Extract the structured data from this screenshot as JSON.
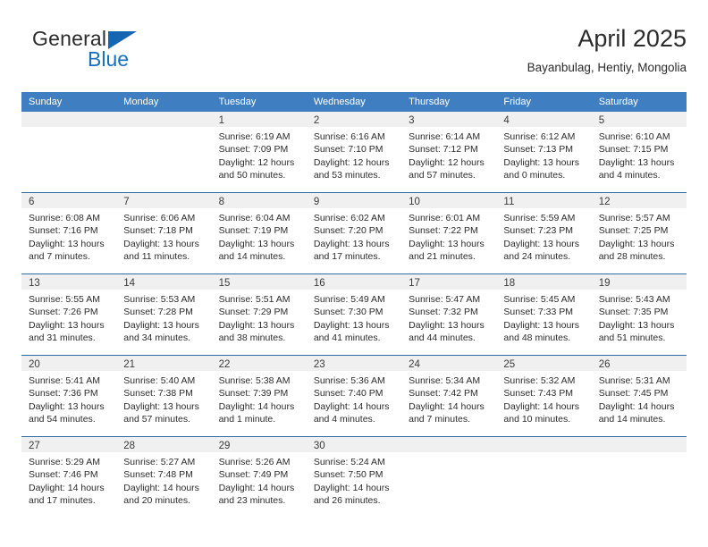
{
  "brand": {
    "name_part1": "General",
    "name_part2": "Blue",
    "accent_color": "#1570bd"
  },
  "header": {
    "title": "April 2025",
    "subtitle": "Bayanbulag, Hentiy, Mongolia"
  },
  "calendar": {
    "header_bg": "#3f7fc1",
    "daynum_bg": "#f0f0f0",
    "weekdays": [
      "Sunday",
      "Monday",
      "Tuesday",
      "Wednesday",
      "Thursday",
      "Friday",
      "Saturday"
    ],
    "weeks": [
      [
        {
          "day": "",
          "sunrise": "",
          "sunset": "",
          "daylight_line1": "",
          "daylight_line2": ""
        },
        {
          "day": "",
          "sunrise": "",
          "sunset": "",
          "daylight_line1": "",
          "daylight_line2": ""
        },
        {
          "day": "1",
          "sunrise": "Sunrise: 6:19 AM",
          "sunset": "Sunset: 7:09 PM",
          "daylight_line1": "Daylight: 12 hours",
          "daylight_line2": "and 50 minutes."
        },
        {
          "day": "2",
          "sunrise": "Sunrise: 6:16 AM",
          "sunset": "Sunset: 7:10 PM",
          "daylight_line1": "Daylight: 12 hours",
          "daylight_line2": "and 53 minutes."
        },
        {
          "day": "3",
          "sunrise": "Sunrise: 6:14 AM",
          "sunset": "Sunset: 7:12 PM",
          "daylight_line1": "Daylight: 12 hours",
          "daylight_line2": "and 57 minutes."
        },
        {
          "day": "4",
          "sunrise": "Sunrise: 6:12 AM",
          "sunset": "Sunset: 7:13 PM",
          "daylight_line1": "Daylight: 13 hours",
          "daylight_line2": "and 0 minutes."
        },
        {
          "day": "5",
          "sunrise": "Sunrise: 6:10 AM",
          "sunset": "Sunset: 7:15 PM",
          "daylight_line1": "Daylight: 13 hours",
          "daylight_line2": "and 4 minutes."
        }
      ],
      [
        {
          "day": "6",
          "sunrise": "Sunrise: 6:08 AM",
          "sunset": "Sunset: 7:16 PM",
          "daylight_line1": "Daylight: 13 hours",
          "daylight_line2": "and 7 minutes."
        },
        {
          "day": "7",
          "sunrise": "Sunrise: 6:06 AM",
          "sunset": "Sunset: 7:18 PM",
          "daylight_line1": "Daylight: 13 hours",
          "daylight_line2": "and 11 minutes."
        },
        {
          "day": "8",
          "sunrise": "Sunrise: 6:04 AM",
          "sunset": "Sunset: 7:19 PM",
          "daylight_line1": "Daylight: 13 hours",
          "daylight_line2": "and 14 minutes."
        },
        {
          "day": "9",
          "sunrise": "Sunrise: 6:02 AM",
          "sunset": "Sunset: 7:20 PM",
          "daylight_line1": "Daylight: 13 hours",
          "daylight_line2": "and 17 minutes."
        },
        {
          "day": "10",
          "sunrise": "Sunrise: 6:01 AM",
          "sunset": "Sunset: 7:22 PM",
          "daylight_line1": "Daylight: 13 hours",
          "daylight_line2": "and 21 minutes."
        },
        {
          "day": "11",
          "sunrise": "Sunrise: 5:59 AM",
          "sunset": "Sunset: 7:23 PM",
          "daylight_line1": "Daylight: 13 hours",
          "daylight_line2": "and 24 minutes."
        },
        {
          "day": "12",
          "sunrise": "Sunrise: 5:57 AM",
          "sunset": "Sunset: 7:25 PM",
          "daylight_line1": "Daylight: 13 hours",
          "daylight_line2": "and 28 minutes."
        }
      ],
      [
        {
          "day": "13",
          "sunrise": "Sunrise: 5:55 AM",
          "sunset": "Sunset: 7:26 PM",
          "daylight_line1": "Daylight: 13 hours",
          "daylight_line2": "and 31 minutes."
        },
        {
          "day": "14",
          "sunrise": "Sunrise: 5:53 AM",
          "sunset": "Sunset: 7:28 PM",
          "daylight_line1": "Daylight: 13 hours",
          "daylight_line2": "and 34 minutes."
        },
        {
          "day": "15",
          "sunrise": "Sunrise: 5:51 AM",
          "sunset": "Sunset: 7:29 PM",
          "daylight_line1": "Daylight: 13 hours",
          "daylight_line2": "and 38 minutes."
        },
        {
          "day": "16",
          "sunrise": "Sunrise: 5:49 AM",
          "sunset": "Sunset: 7:30 PM",
          "daylight_line1": "Daylight: 13 hours",
          "daylight_line2": "and 41 minutes."
        },
        {
          "day": "17",
          "sunrise": "Sunrise: 5:47 AM",
          "sunset": "Sunset: 7:32 PM",
          "daylight_line1": "Daylight: 13 hours",
          "daylight_line2": "and 44 minutes."
        },
        {
          "day": "18",
          "sunrise": "Sunrise: 5:45 AM",
          "sunset": "Sunset: 7:33 PM",
          "daylight_line1": "Daylight: 13 hours",
          "daylight_line2": "and 48 minutes."
        },
        {
          "day": "19",
          "sunrise": "Sunrise: 5:43 AM",
          "sunset": "Sunset: 7:35 PM",
          "daylight_line1": "Daylight: 13 hours",
          "daylight_line2": "and 51 minutes."
        }
      ],
      [
        {
          "day": "20",
          "sunrise": "Sunrise: 5:41 AM",
          "sunset": "Sunset: 7:36 PM",
          "daylight_line1": "Daylight: 13 hours",
          "daylight_line2": "and 54 minutes."
        },
        {
          "day": "21",
          "sunrise": "Sunrise: 5:40 AM",
          "sunset": "Sunset: 7:38 PM",
          "daylight_line1": "Daylight: 13 hours",
          "daylight_line2": "and 57 minutes."
        },
        {
          "day": "22",
          "sunrise": "Sunrise: 5:38 AM",
          "sunset": "Sunset: 7:39 PM",
          "daylight_line1": "Daylight: 14 hours",
          "daylight_line2": "and 1 minute."
        },
        {
          "day": "23",
          "sunrise": "Sunrise: 5:36 AM",
          "sunset": "Sunset: 7:40 PM",
          "daylight_line1": "Daylight: 14 hours",
          "daylight_line2": "and 4 minutes."
        },
        {
          "day": "24",
          "sunrise": "Sunrise: 5:34 AM",
          "sunset": "Sunset: 7:42 PM",
          "daylight_line1": "Daylight: 14 hours",
          "daylight_line2": "and 7 minutes."
        },
        {
          "day": "25",
          "sunrise": "Sunrise: 5:32 AM",
          "sunset": "Sunset: 7:43 PM",
          "daylight_line1": "Daylight: 14 hours",
          "daylight_line2": "and 10 minutes."
        },
        {
          "day": "26",
          "sunrise": "Sunrise: 5:31 AM",
          "sunset": "Sunset: 7:45 PM",
          "daylight_line1": "Daylight: 14 hours",
          "daylight_line2": "and 14 minutes."
        }
      ],
      [
        {
          "day": "27",
          "sunrise": "Sunrise: 5:29 AM",
          "sunset": "Sunset: 7:46 PM",
          "daylight_line1": "Daylight: 14 hours",
          "daylight_line2": "and 17 minutes."
        },
        {
          "day": "28",
          "sunrise": "Sunrise: 5:27 AM",
          "sunset": "Sunset: 7:48 PM",
          "daylight_line1": "Daylight: 14 hours",
          "daylight_line2": "and 20 minutes."
        },
        {
          "day": "29",
          "sunrise": "Sunrise: 5:26 AM",
          "sunset": "Sunset: 7:49 PM",
          "daylight_line1": "Daylight: 14 hours",
          "daylight_line2": "and 23 minutes."
        },
        {
          "day": "30",
          "sunrise": "Sunrise: 5:24 AM",
          "sunset": "Sunset: 7:50 PM",
          "daylight_line1": "Daylight: 14 hours",
          "daylight_line2": "and 26 minutes."
        },
        {
          "day": "",
          "sunrise": "",
          "sunset": "",
          "daylight_line1": "",
          "daylight_line2": ""
        },
        {
          "day": "",
          "sunrise": "",
          "sunset": "",
          "daylight_line1": "",
          "daylight_line2": ""
        },
        {
          "day": "",
          "sunrise": "",
          "sunset": "",
          "daylight_line1": "",
          "daylight_line2": ""
        }
      ]
    ]
  }
}
